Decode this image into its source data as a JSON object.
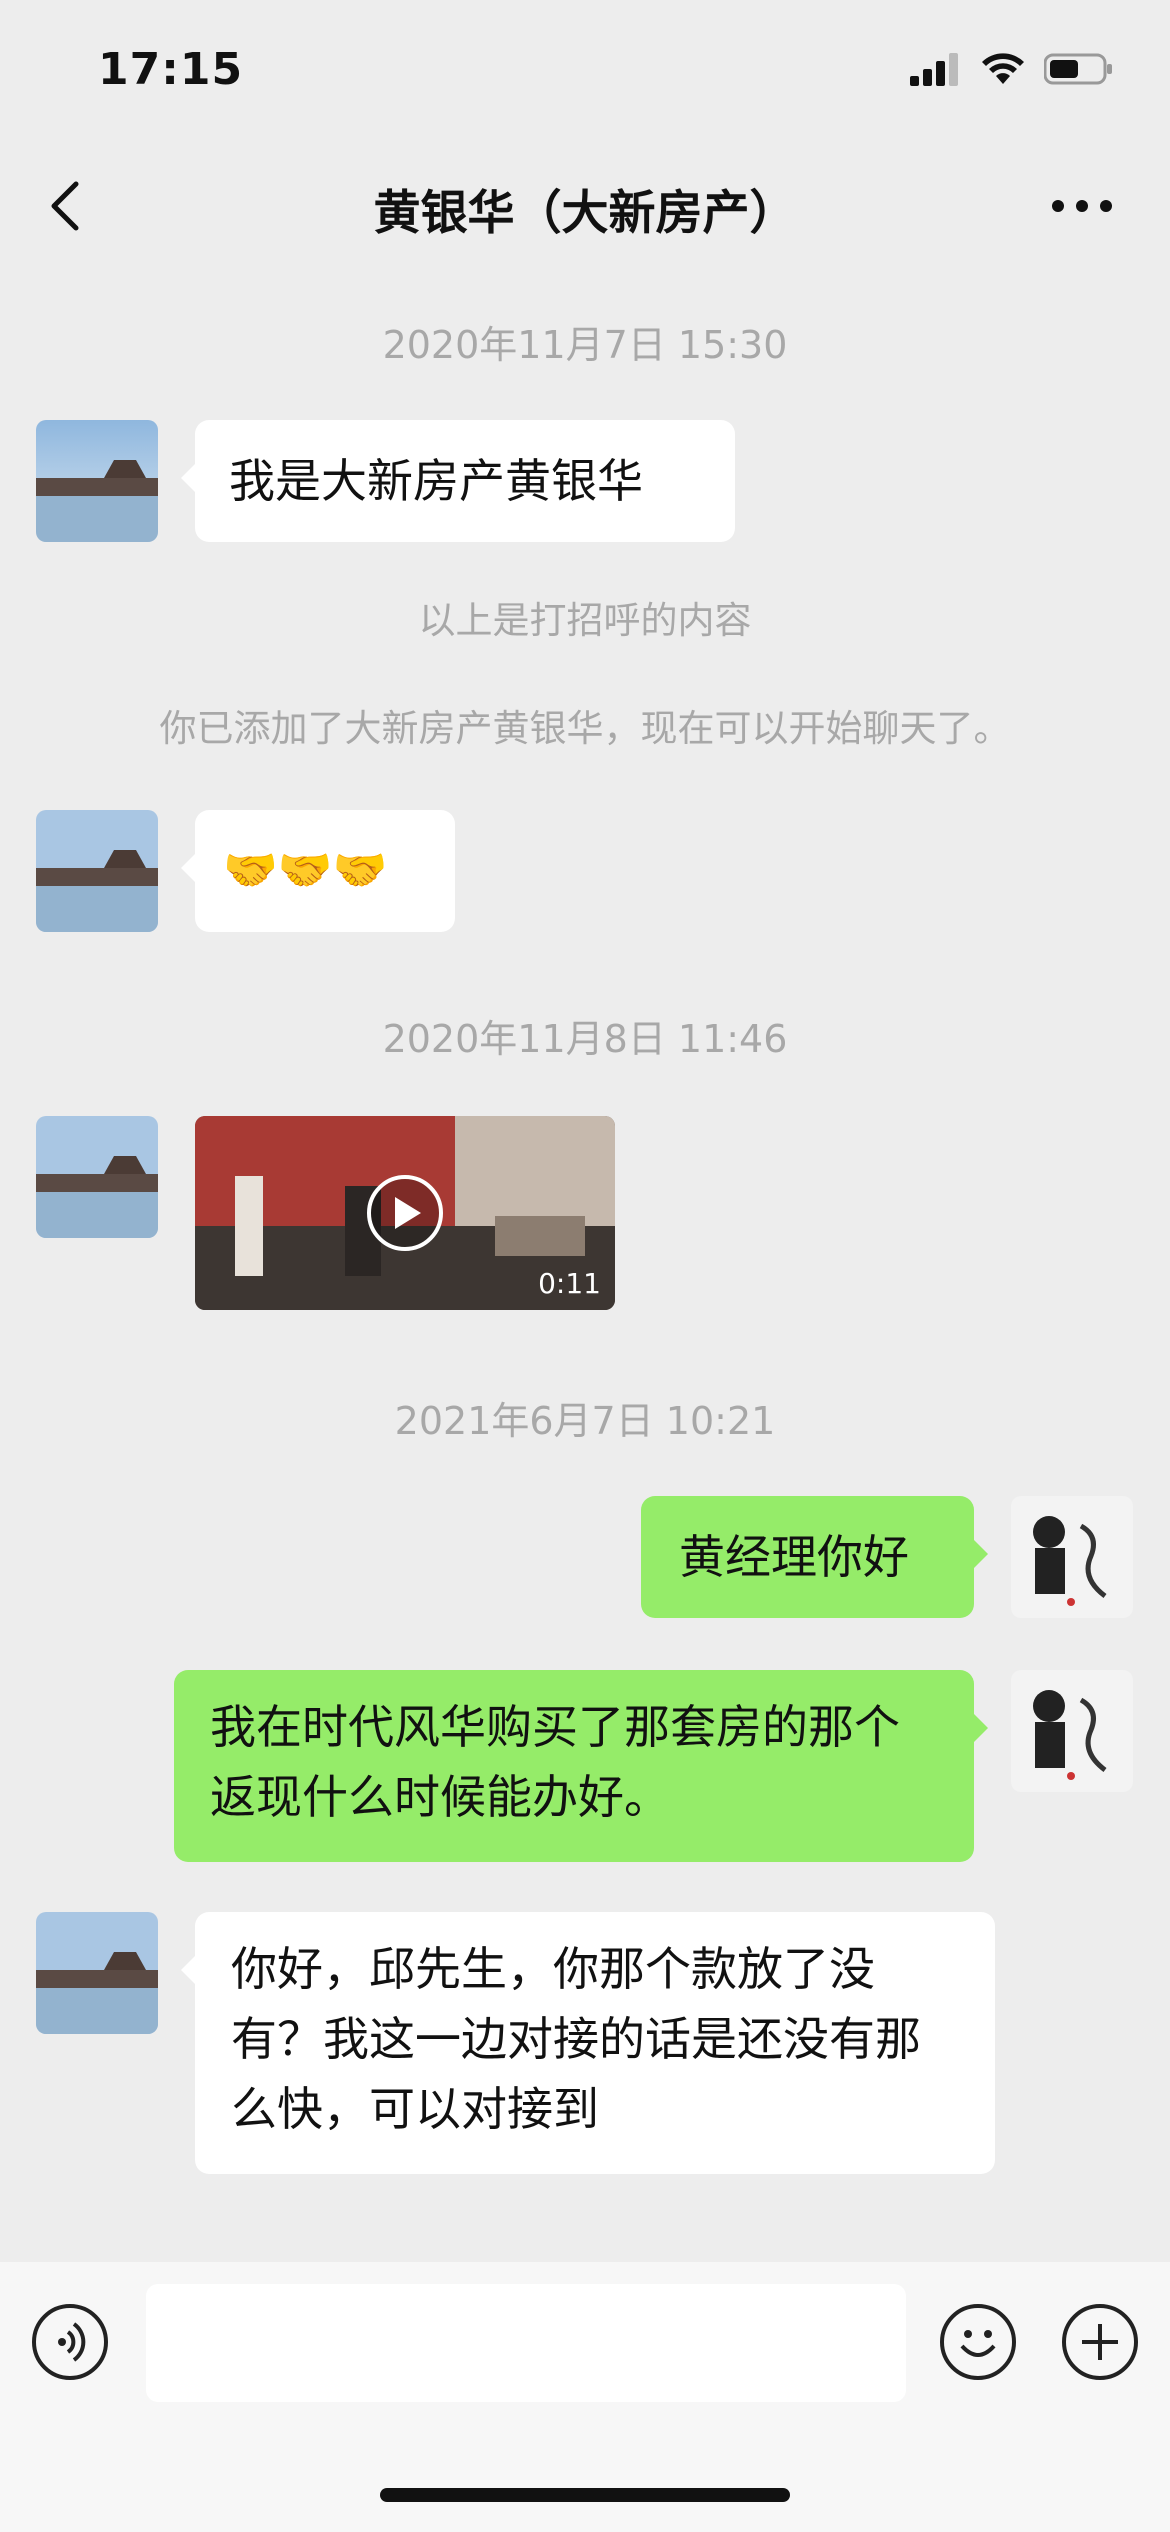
{
  "status": {
    "time": "17:15"
  },
  "header": {
    "title": "黄银华（大新房产）"
  },
  "messages": {
    "ts1": "2020年11月7日 15:30",
    "m1": "我是大新房产黄银华",
    "sys1": "以上是打招呼的内容",
    "sys2": "你已添加了大新房产黄银华，现在可以开始聊天了。",
    "m2": "🤝🤝🤝",
    "ts2": "2020年11月8日 11:46",
    "video_duration": "0:11",
    "ts3": "2021年6月7日 10:21",
    "m3": "黄经理你好",
    "m4": "我在时代风华购买了那套房的那个返现什么时候能办好。",
    "m5": "你好，邱先生，你那个款放了没有？我这一边对接的话是还没有那么快，可以对接到"
  },
  "icons": {
    "back": "chevron-left-icon",
    "more": "more-dots-icon",
    "voice": "voice-icon",
    "emoji": "emoji-icon",
    "plus": "plus-icon",
    "play": "play-icon"
  },
  "colors": {
    "background": "#ededed",
    "incoming_bubble": "#ffffff",
    "outgoing_bubble": "#95ec69",
    "timestamp": "#a8a8a8"
  }
}
